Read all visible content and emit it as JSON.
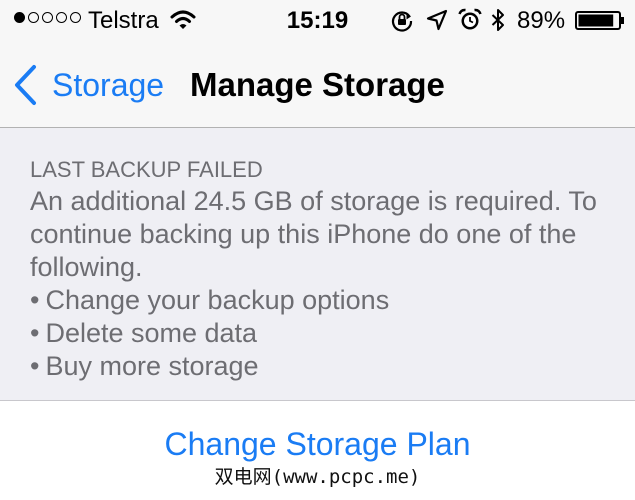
{
  "status_bar": {
    "carrier": "Telstra",
    "time": "15:19",
    "battery_percent": "89%",
    "signal_strength": {
      "filled": 1,
      "total": 5
    },
    "battery_level": 0.89,
    "icons": [
      "wifi-icon",
      "rotation-lock-icon",
      "location-icon",
      "alarm-icon",
      "bluetooth-icon",
      "battery-icon"
    ]
  },
  "nav": {
    "back_label": "Storage",
    "title": "Manage Storage"
  },
  "notice": {
    "heading": "LAST BACKUP FAILED",
    "body": "An additional 24.5 GB of storage is required. To continue backing up this iPhone do one of the following.",
    "options": [
      "Change your backup options",
      "Delete some data",
      "Buy more storage"
    ],
    "bullet": "•"
  },
  "action": {
    "label": "Change Storage Plan"
  },
  "watermark": {
    "text": "双电网(www.pcpc.me)"
  },
  "colors": {
    "accent": "#1a7cf4",
    "secondary_text": "#6d6d72",
    "background": "#efeff4"
  }
}
